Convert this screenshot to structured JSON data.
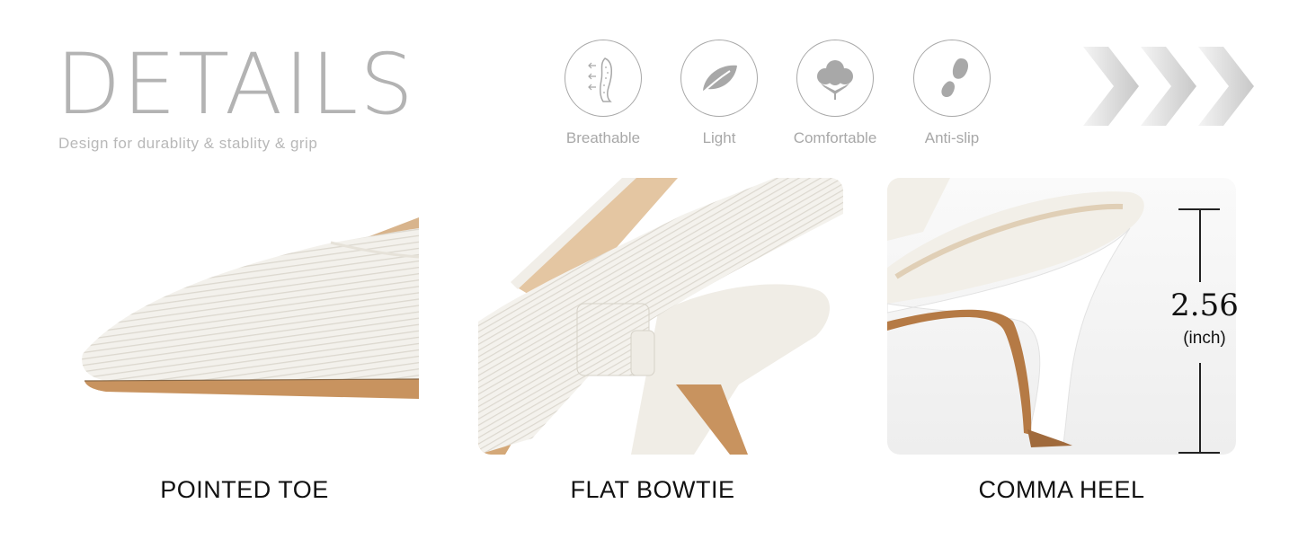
{
  "header": {
    "title": "DETAILS",
    "subtitle": "Design for durablity & stablity & grip"
  },
  "features": [
    {
      "label": "Breathable",
      "icon": "breathable-icon"
    },
    {
      "label": "Light",
      "icon": "leaf-icon"
    },
    {
      "label": "Comfortable",
      "icon": "cotton-icon"
    },
    {
      "label": "Anti-slip",
      "icon": "footprint-icon"
    }
  ],
  "decor": {
    "chevrons_icon": "chevron-right-icon"
  },
  "panels": [
    {
      "caption": "POINTED TOE"
    },
    {
      "caption": "FLAT BOWTIE"
    },
    {
      "caption": "COMMA HEEL"
    }
  ],
  "measurement": {
    "value": "2.56",
    "unit": "(inch)"
  },
  "colors": {
    "accent_gray": "#b3b3b3",
    "caption": "#111111",
    "shoe_white": "#f2efe8",
    "sole_tan": "#c8935f"
  }
}
